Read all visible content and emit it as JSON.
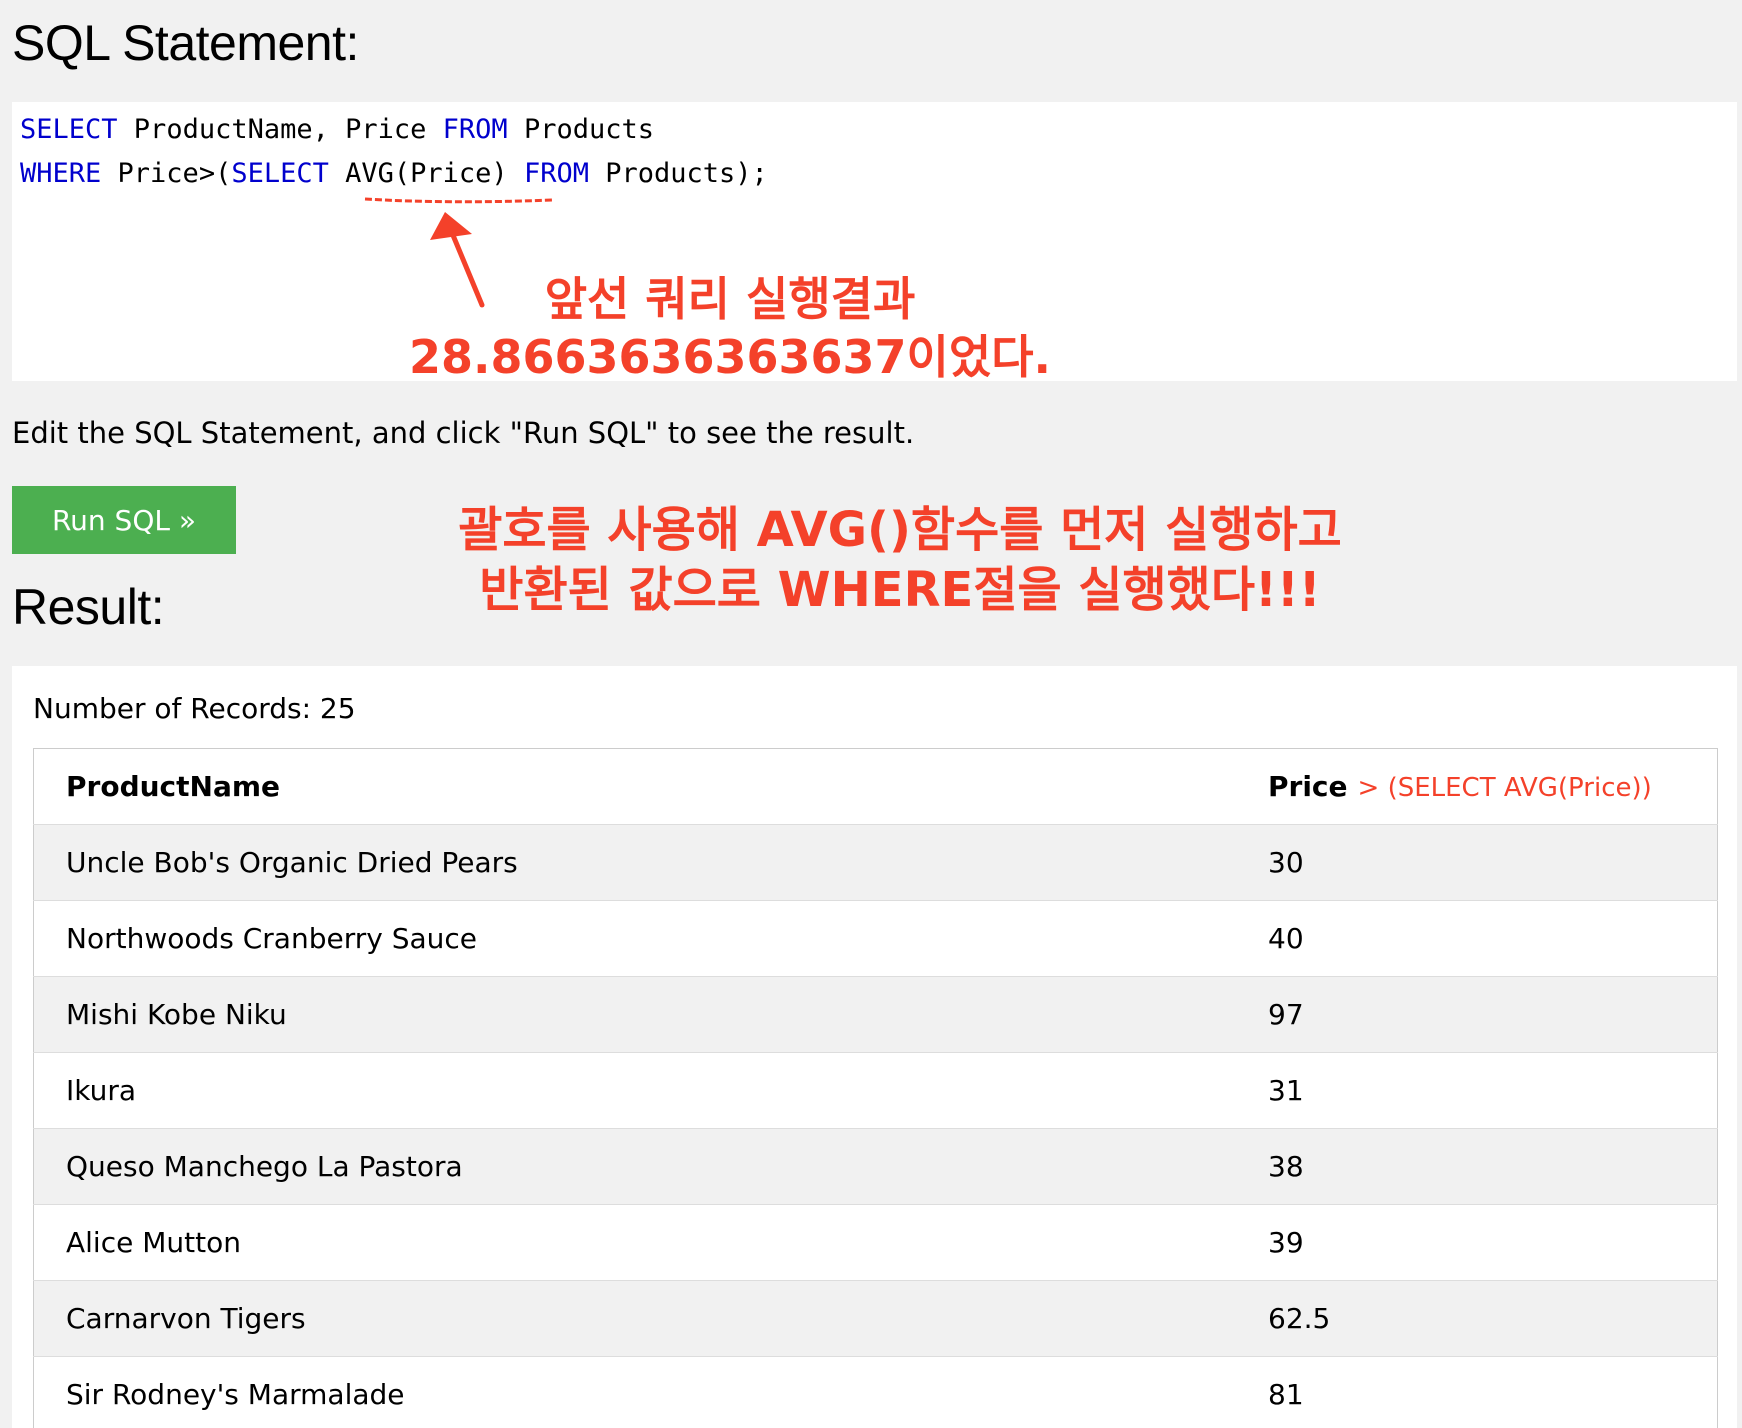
{
  "sql_section": {
    "heading": "SQL Statement:",
    "code_line1": [
      {
        "text": "SELECT",
        "kw": true
      },
      {
        "text": " ProductName, Price ",
        "kw": false
      },
      {
        "text": "FROM",
        "kw": true
      },
      {
        "text": " Products",
        "kw": false
      }
    ],
    "code_line2": [
      {
        "text": "WHERE",
        "kw": true
      },
      {
        "text": " Price>(",
        "kw": false
      },
      {
        "text": "SELECT",
        "kw": true
      },
      {
        "text": " AVG(Price) ",
        "kw": false
      },
      {
        "text": "FROM",
        "kw": true
      },
      {
        "text": " Products);",
        "kw": false
      }
    ]
  },
  "annotations": {
    "avg_note_line1": "앞선 쿼리 실행결과",
    "avg_note_line2": "28.8663636363637이었다.",
    "paren_note_line1": "괄호를 사용해 AVG()함수를 먼저 실행하고",
    "paren_note_line2": "반환된 값으로 WHERE절을 실행했다!!!",
    "price_note": "> (SELECT AVG(Price))",
    "color": "#f4412a"
  },
  "instruction": "Edit the SQL Statement, and click \"Run SQL\" to see the result.",
  "run_button": {
    "label": "Run SQL »",
    "color": "#4caf50"
  },
  "result": {
    "heading": "Result:",
    "record_count_label": "Number of Records: 25",
    "columns": [
      "ProductName",
      "Price"
    ],
    "rows": [
      [
        "Uncle Bob's Organic Dried Pears",
        "30"
      ],
      [
        "Northwoods Cranberry Sauce",
        "40"
      ],
      [
        "Mishi Kobe Niku",
        "97"
      ],
      [
        "Ikura",
        "31"
      ],
      [
        "Queso Manchego La Pastora",
        "38"
      ],
      [
        "Alice Mutton",
        "39"
      ],
      [
        "Carnarvon Tigers",
        "62.5"
      ],
      [
        "Sir Rodney's Marmalade",
        "81"
      ]
    ]
  },
  "keyword_color": "#0000cd"
}
